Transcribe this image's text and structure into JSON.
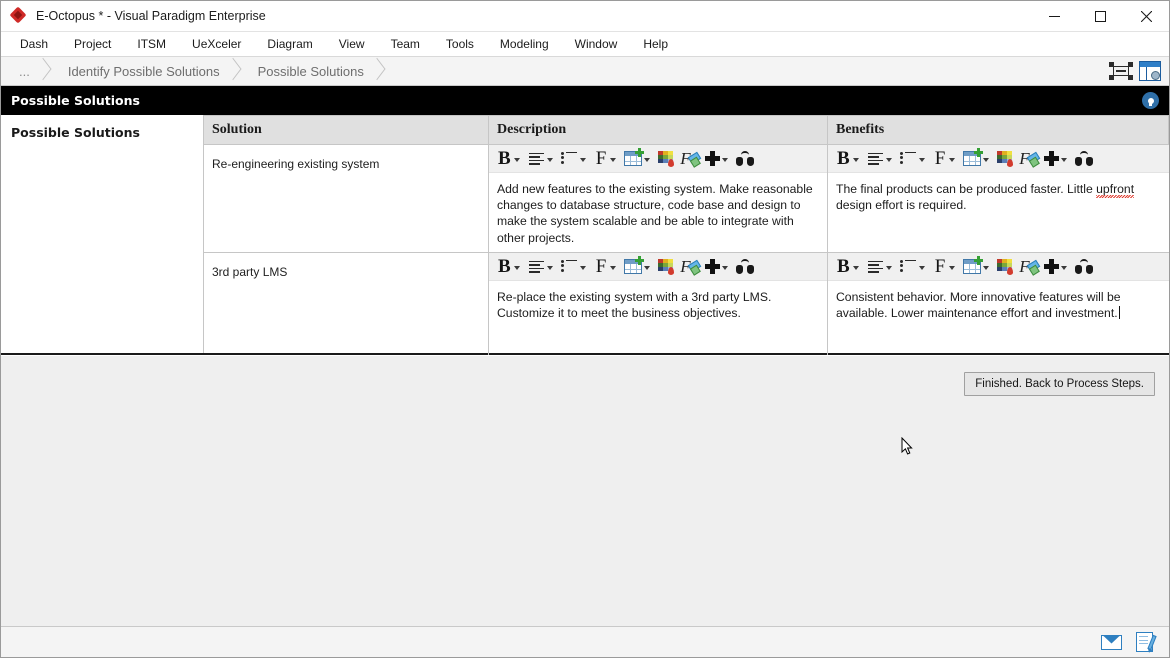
{
  "window": {
    "title": "E-Octopus * - Visual Paradigm Enterprise",
    "logo_icon": "vp-diamond-logo",
    "minimize_label": "—",
    "maximize_label": "☐",
    "close_label": "✕"
  },
  "menu": {
    "items": [
      {
        "label": "Dash"
      },
      {
        "label": "Project"
      },
      {
        "label": "ITSM"
      },
      {
        "label": "UeXceler"
      },
      {
        "label": "Diagram"
      },
      {
        "label": "View"
      },
      {
        "label": "Team"
      },
      {
        "label": "Tools"
      },
      {
        "label": "Modeling"
      },
      {
        "label": "Window"
      },
      {
        "label": "Help"
      }
    ]
  },
  "breadcrumb": {
    "items": [
      {
        "label": "..."
      },
      {
        "label": "Identify Possible Solutions"
      },
      {
        "label": "Possible Solutions"
      }
    ],
    "tools": [
      {
        "icon": "fit-to-screen-icon"
      },
      {
        "icon": "panel-settings-icon"
      }
    ]
  },
  "section": {
    "title": "Possible Solutions",
    "tip_icon": "lightbulb-tip-icon"
  },
  "panel": {
    "side_label": "Possible Solutions"
  },
  "table": {
    "columns": [
      {
        "key": "solution",
        "label": "Solution"
      },
      {
        "key": "description",
        "label": "Description"
      },
      {
        "key": "benefits",
        "label": "Benefits"
      }
    ],
    "rows": [
      {
        "solution": "Re-engineering existing system",
        "description": "Add new features to the existing system. Make reasonable changes to database structure, code base and design to make the system scalable and be able to integrate with other projects.",
        "benefits_pre": "The final products can be produced faster. Little ",
        "benefits_misspelled": "upfront",
        "benefits_post": " design effort is required."
      },
      {
        "solution": "3rd party LMS",
        "description": "Re-place the existing system with a 3rd party LMS. Customize it to meet the business objectives.",
        "benefits_pre": "Consistent behavior. More innovative features will be available. Lower maintenance effort and investment.",
        "benefits_misspelled": "",
        "benefits_post": ""
      }
    ]
  },
  "rich_text_toolbar": {
    "buttons": [
      {
        "name": "bold-button",
        "label": "B",
        "icon": "bold-icon",
        "has_dropdown": true
      },
      {
        "name": "align-button",
        "label": "",
        "icon": "align-left-icon",
        "has_dropdown": true
      },
      {
        "name": "list-button",
        "label": "",
        "icon": "bullet-list-icon",
        "has_dropdown": true
      },
      {
        "name": "font-button",
        "label": "F",
        "icon": "font-icon",
        "has_dropdown": true
      },
      {
        "name": "table-button",
        "label": "",
        "icon": "insert-table-icon",
        "has_dropdown": true
      },
      {
        "name": "color-button",
        "label": "",
        "icon": "color-palette-icon",
        "has_dropdown": false
      },
      {
        "name": "format-eraser-button",
        "label": "",
        "icon": "clear-format-icon",
        "has_dropdown": false
      },
      {
        "name": "insert-button",
        "label": "",
        "icon": "plus-icon",
        "has_dropdown": true
      },
      {
        "name": "find-button",
        "label": "",
        "icon": "binoculars-icon",
        "has_dropdown": false
      }
    ]
  },
  "footer": {
    "finish_button": "Finished. Back to Process Steps."
  },
  "statusbar": {
    "icons": [
      {
        "name": "mail-icon"
      },
      {
        "name": "edit-document-icon"
      }
    ]
  },
  "colors": {
    "accent": "#2f6fa8",
    "section_bar": "#000000",
    "table_header": "#e0e0e0",
    "panel_bg": "#efefef",
    "logo_red": "#cf2a27"
  }
}
